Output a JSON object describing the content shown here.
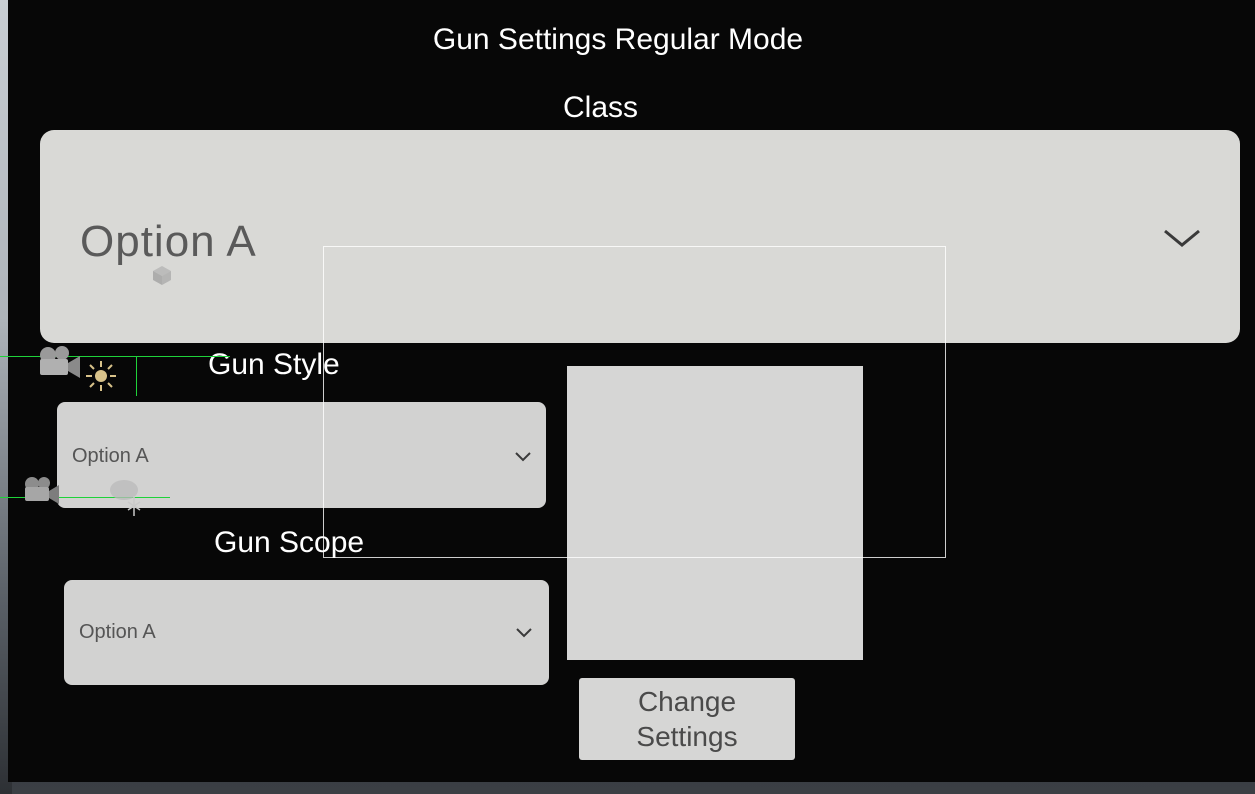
{
  "header": {
    "title": "Gun Settings Regular Mode"
  },
  "class_section": {
    "label": "Class",
    "selected": "Option A"
  },
  "gun_style": {
    "label": "Gun Style",
    "selected": "Option A"
  },
  "gun_scope": {
    "label": "Gun Scope",
    "selected": "Option A"
  },
  "actions": {
    "change_settings_label": "Change Settings"
  },
  "icons": {
    "dropdown": "chevron-down-icon",
    "scene_camera": "camera-gizmo-icon",
    "scene_light": "light-gizmo-icon",
    "scene_object": "cube-gizmo-icon"
  },
  "colors": {
    "panel_background": "#070707",
    "dropdown_background": "#d2d2d1",
    "text_on_panel": "#ffffff",
    "text_on_dropdown": "#555555",
    "gizmo_line": "#1fd23a"
  }
}
